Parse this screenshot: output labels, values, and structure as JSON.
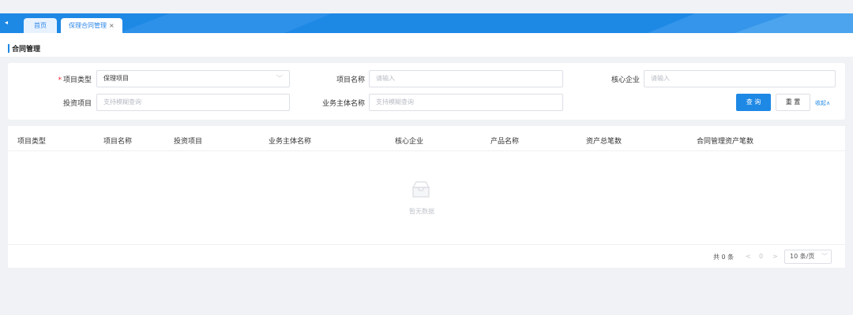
{
  "tabs": {
    "home": "首页",
    "active": "保理合同管理",
    "close": "×"
  },
  "page": {
    "title": "合同管理"
  },
  "filters": {
    "project_type": {
      "label": "项目类型",
      "value": "保理项目"
    },
    "project_name": {
      "label": "项目名称",
      "placeholder": "请输入"
    },
    "core_enterprise": {
      "label": "核心企业",
      "placeholder": "请输入"
    },
    "investment_project": {
      "label": "投资项目",
      "placeholder": "支持模糊查询"
    },
    "business_entity": {
      "label": "业务主体名称",
      "placeholder": "支持模糊查询"
    },
    "query_label": "查 询",
    "reset_label": "重 置",
    "collapse_label": "收起∧"
  },
  "table": {
    "columns": [
      "项目类型",
      "项目名称",
      "投资项目",
      "业务主体名称",
      "核心企业",
      "产品名称",
      "资产总笔数",
      "合同管理资产笔数"
    ],
    "empty_text": "暂无数据"
  },
  "pagination": {
    "total": "共 0 条",
    "prev": "<",
    "current": "0",
    "next": ">",
    "page_size": "10 条/页"
  },
  "colors": {
    "accent": "#1e88e5"
  }
}
